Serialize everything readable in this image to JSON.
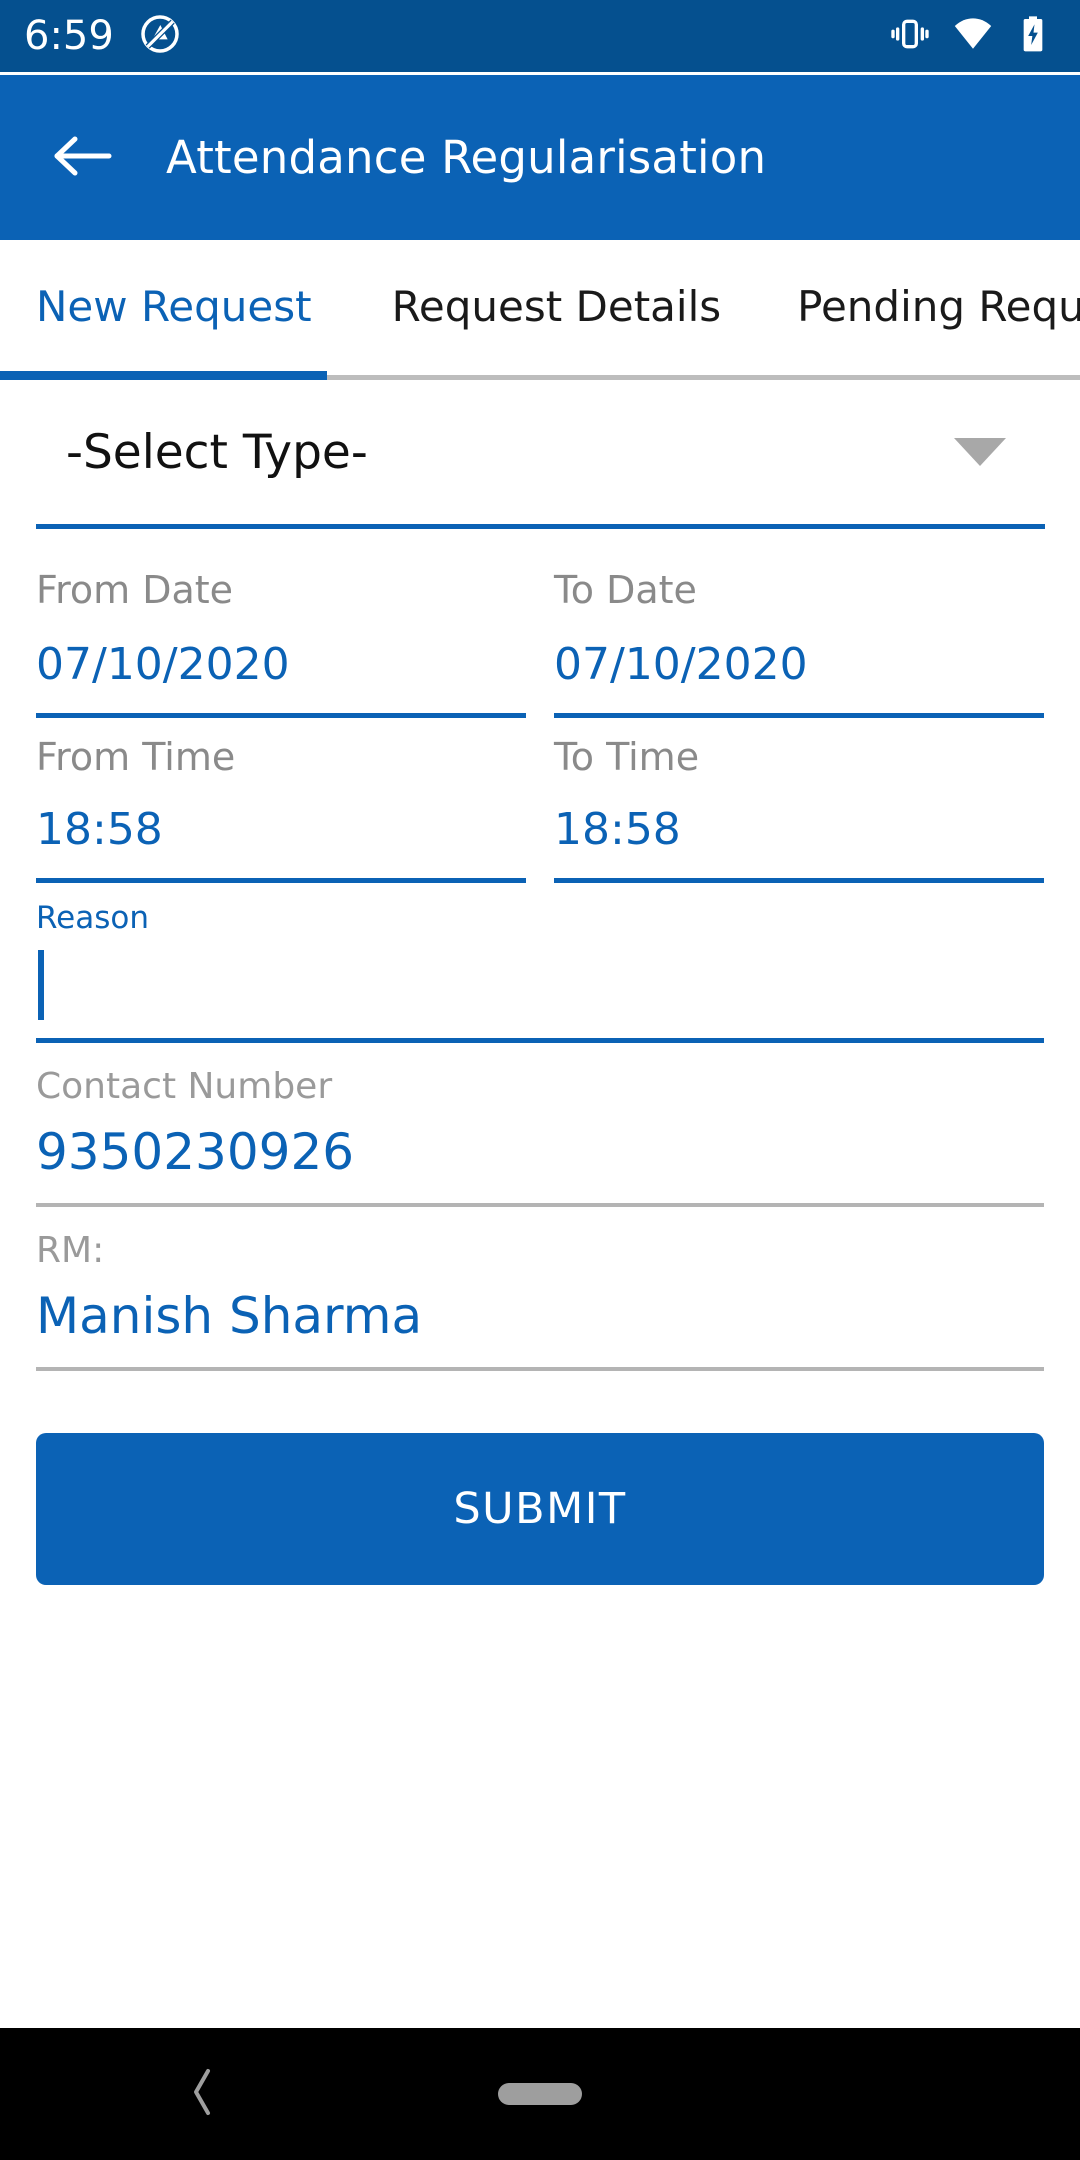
{
  "status_bar": {
    "time": "6:59",
    "icons": [
      "location-off-icon",
      "vibrate-icon",
      "wifi-icon",
      "battery-charging-icon"
    ],
    "background_color": "#05508F"
  },
  "app_bar": {
    "back_icon": "arrow-left-icon",
    "title": "Attendance Regularisation",
    "background_color": "#0B62B5"
  },
  "tabs": {
    "items": [
      {
        "label": "New Request",
        "active": true
      },
      {
        "label": "Request Details",
        "active": false
      },
      {
        "label": "Pending Request",
        "active": false
      }
    ],
    "indicator_color": "#0B62B5"
  },
  "form": {
    "type_select": {
      "value": "-Select Type-",
      "caret_icon": "chevron-down-icon"
    },
    "from_date": {
      "label": "From Date",
      "value": "07/10/2020"
    },
    "to_date": {
      "label": "To Date",
      "value": "07/10/2020"
    },
    "from_time": {
      "label": "From Time",
      "value": "18:58"
    },
    "to_time": {
      "label": "To Time",
      "value": "18:58"
    },
    "reason": {
      "label": "Reason",
      "value": "",
      "focused": true
    },
    "contact_number": {
      "label": "Contact Number",
      "value": "9350230926"
    },
    "rm": {
      "label": "RM:",
      "value": "Manish Sharma"
    },
    "submit": {
      "label": "SUBMIT",
      "color": "#0B62B5"
    }
  },
  "nav_bar": {
    "back_icon": "chevron-left-icon",
    "home_icon": "home-pill-icon",
    "background_color": "#000000"
  }
}
